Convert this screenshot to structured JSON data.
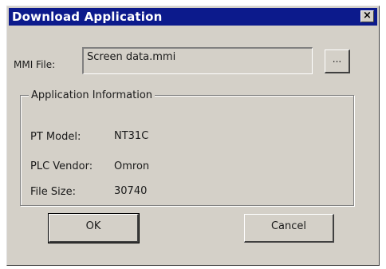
{
  "window": {
    "title": "Download Application",
    "close_label": "×"
  },
  "mmi_file": {
    "label": "MMI File:",
    "value": "Screen data.mmi",
    "browse_label": "..."
  },
  "app_info": {
    "group_title": "Application Information",
    "rows": [
      {
        "label": "PT Model:",
        "value": "NT31C"
      },
      {
        "label": "PLC Vendor:",
        "value": "Omron"
      },
      {
        "label": "File Size:",
        "value": "30740"
      }
    ]
  },
  "buttons": {
    "ok_label": "OK",
    "cancel_label": "Cancel"
  }
}
